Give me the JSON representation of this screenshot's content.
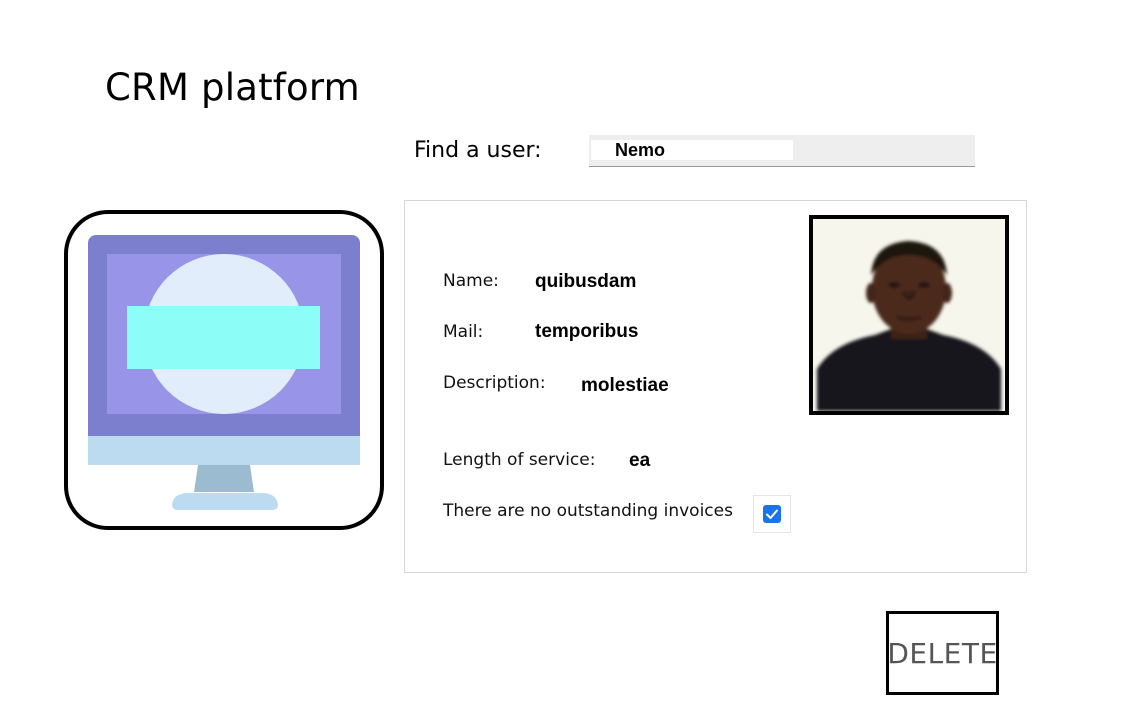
{
  "app": {
    "title": "CRM platform"
  },
  "search": {
    "label": "Find a user:",
    "value": "Nemo"
  },
  "illustration": {
    "icon": "computer-monitor-icon"
  },
  "profile": {
    "fields": [
      {
        "label": "Name:",
        "value": "quibusdam"
      },
      {
        "label": "Mail:",
        "value": "temporibus"
      },
      {
        "label": "Description:",
        "value": "molestiae"
      },
      {
        "label": "Length of service:",
        "value": "ea"
      }
    ],
    "invoices_label": "There are no outstanding invoices",
    "invoices_checked": true,
    "photo": "user-portrait"
  },
  "actions": {
    "delete_label": "DELETE"
  },
  "colors": {
    "monitor_frame": "#7b7fce",
    "monitor_screen": "#9894e8",
    "monitor_circle": "#e1edfb",
    "monitor_banner": "#8dfdf8",
    "monitor_stand": "#9bbbd0",
    "monitor_base": "#bcdaf0",
    "checkbox": "#1a73e8"
  }
}
